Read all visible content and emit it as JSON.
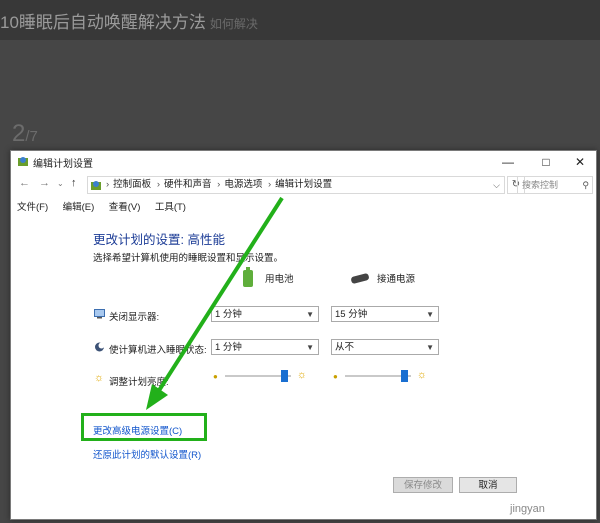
{
  "article": {
    "title": "10睡眠后自动唤醒解决方法",
    "title_suffix": "如何解决",
    "step": "2",
    "step_total": "/7"
  },
  "window": {
    "title": "编辑计划设置",
    "controls": {
      "minimize": "—",
      "maximize": "□",
      "close": "✕"
    }
  },
  "address": {
    "breadcrumbs": [
      "控制面板",
      "硬件和声音",
      "电源选项",
      "编辑计划设置"
    ],
    "search_placeholder": "搜索控制"
  },
  "menu": [
    "文件(F)",
    "编辑(E)",
    "查看(V)",
    "工具(T)"
  ],
  "plan": {
    "heading": "更改计划的设置: 高性能",
    "subtext": "选择希望计算机使用的睡眠设置和显示设置。",
    "column_battery": "用电池",
    "column_plugged": "接通电源",
    "rows": [
      {
        "label": "关闭显示器:",
        "battery": "1 分钟",
        "plugged": "15 分钟"
      },
      {
        "label": "使计算机进入睡眠状态:",
        "battery": "1 分钟",
        "plugged": "从不"
      }
    ],
    "brightness_label": "调整计划亮度:",
    "brightness_battery": 0.9,
    "brightness_plugged": 0.9
  },
  "links": {
    "advanced": "更改高级电源设置(C)",
    "restore": "还原此计划的默认设置(R)"
  },
  "buttons": {
    "save": "保存修改",
    "cancel": "取消"
  },
  "watermark": "jingyan",
  "colors": {
    "highlight": "#22b01a",
    "link": "#1155cc",
    "heading": "#1c3c96"
  },
  "icons": [
    "back-arrow-icon",
    "forward-arrow-icon",
    "up-arrow-icon",
    "refresh-icon",
    "search-icon",
    "battery-icon",
    "plug-icon",
    "monitor-icon",
    "moon-icon",
    "sun-icon"
  ]
}
